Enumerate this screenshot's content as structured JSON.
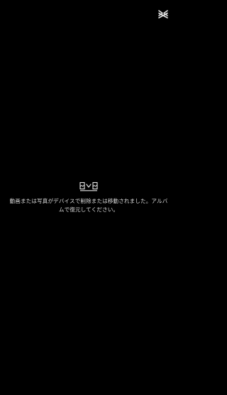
{
  "app": {
    "logo_icon": "capcut-logo-icon"
  },
  "empty_state": {
    "icon": "missing-media-icon",
    "message": "動画または写真がデバイスで削除または移動されました。アルバムで復元してください。"
  },
  "colors": {
    "background": "#000000",
    "text": "#dcdcdc",
    "icon": "#e6e6e6"
  }
}
